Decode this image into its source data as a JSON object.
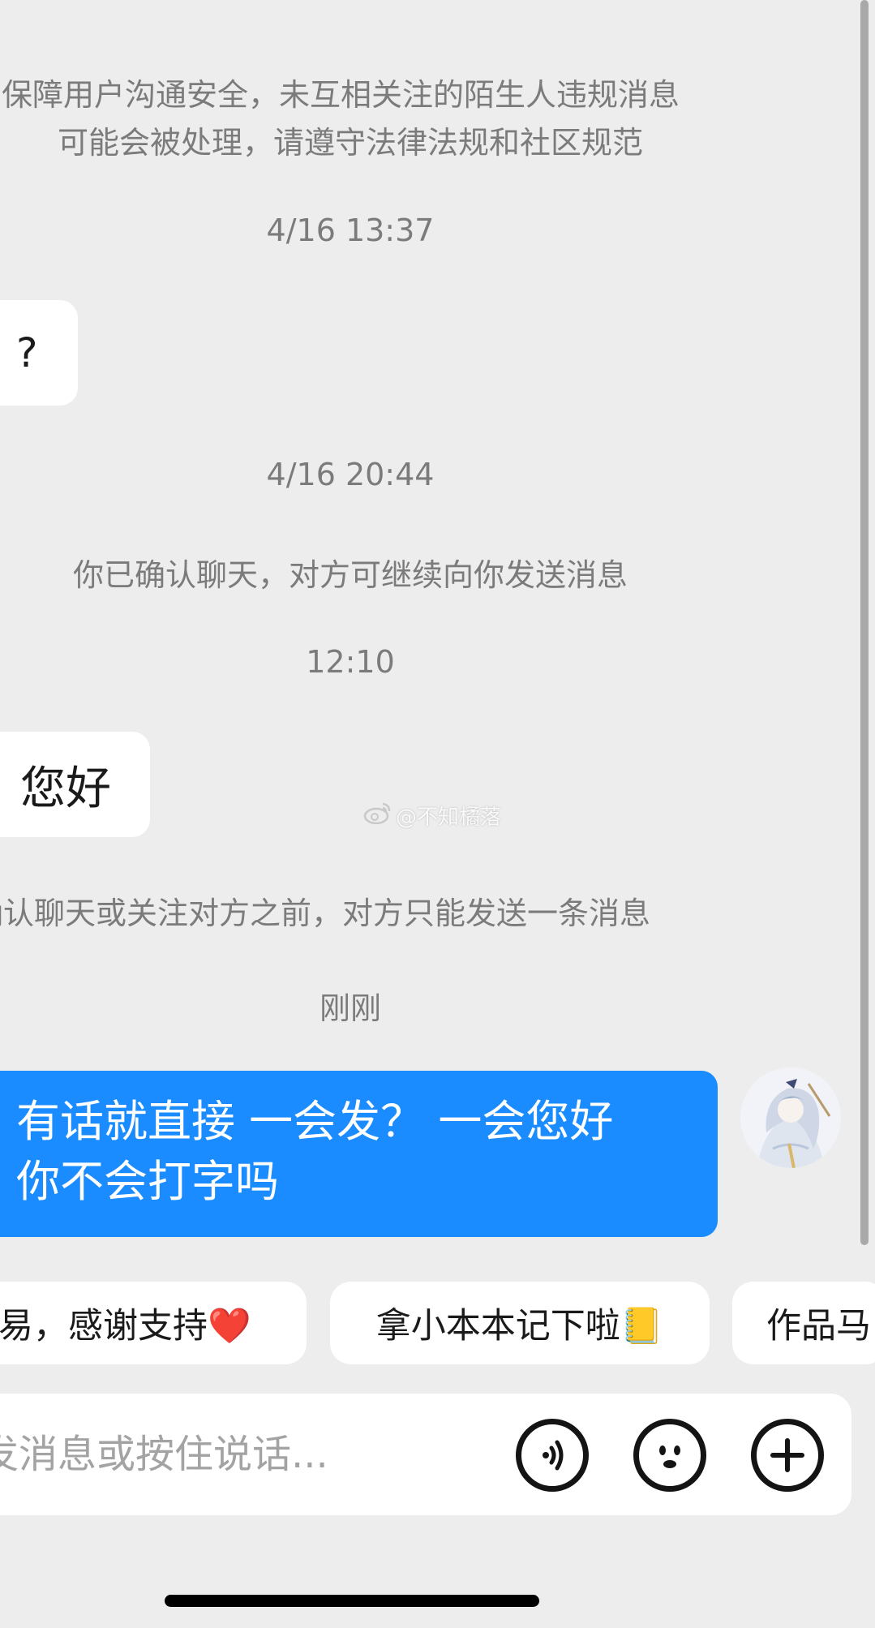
{
  "chat": {
    "safety_notice_line1": "保障用户沟通安全，未互相关注的陌生人违规消息",
    "safety_notice_line2": "可能会被处理，请遵守法律法规和社区规范",
    "timestamp_1": "4/16 13:37",
    "message_1": "?",
    "timestamp_2": "4/16 20:44",
    "confirm_notice": "你已确认聊天，对方可继续向你发送消息",
    "timestamp_3": "12:10",
    "message_2": "您好",
    "limit_notice": "确认聊天或关注对方之前，对方只能发送一条消息",
    "timestamp_4": "刚刚",
    "message_3_line1": "有话就直接 一会发？ 一会您好",
    "message_3_line2": "你不会打字吗"
  },
  "watermark": {
    "text": "@不知橘落"
  },
  "quick_replies": [
    {
      "label": "易，感谢支持❤️"
    },
    {
      "label": "拿小本本记下啦📒"
    },
    {
      "label": "作品马"
    }
  ],
  "input": {
    "placeholder": "发消息或按住说话..."
  },
  "icons": {
    "voice": "voice-wave-icon",
    "emoji": "emoji-face-icon",
    "more": "plus-circle-icon"
  },
  "colors": {
    "background": "#ededed",
    "sent_bubble": "#1a8cff",
    "received_bubble": "#ffffff",
    "system_text": "#7b7b7b"
  }
}
